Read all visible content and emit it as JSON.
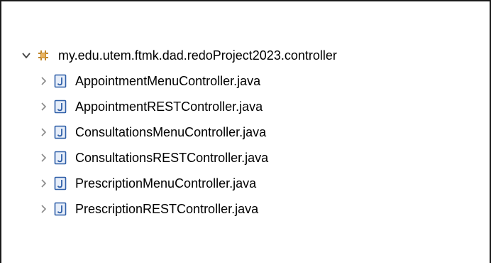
{
  "package": {
    "name": "my.edu.utem.ftmk.dad.redoProject2023.controller",
    "icon": "package-icon",
    "expanded": true
  },
  "files": [
    {
      "name": "AppointmentMenuController.java",
      "icon": "java-file-icon"
    },
    {
      "name": "AppointmentRESTController.java",
      "icon": "java-file-icon"
    },
    {
      "name": "ConsultationsMenuController.java",
      "icon": "java-file-icon"
    },
    {
      "name": "ConsultationsRESTController.java",
      "icon": "java-file-icon"
    },
    {
      "name": "PrescriptionMenuController.java",
      "icon": "java-file-icon"
    },
    {
      "name": "PrescriptionRESTController.java",
      "icon": "java-file-icon"
    }
  ],
  "colors": {
    "package_icon": "#c0862b",
    "java_icon_border": "#2f5fa8",
    "java_icon_fill": "#e7eef9",
    "twisty": "#5f5f5f"
  }
}
